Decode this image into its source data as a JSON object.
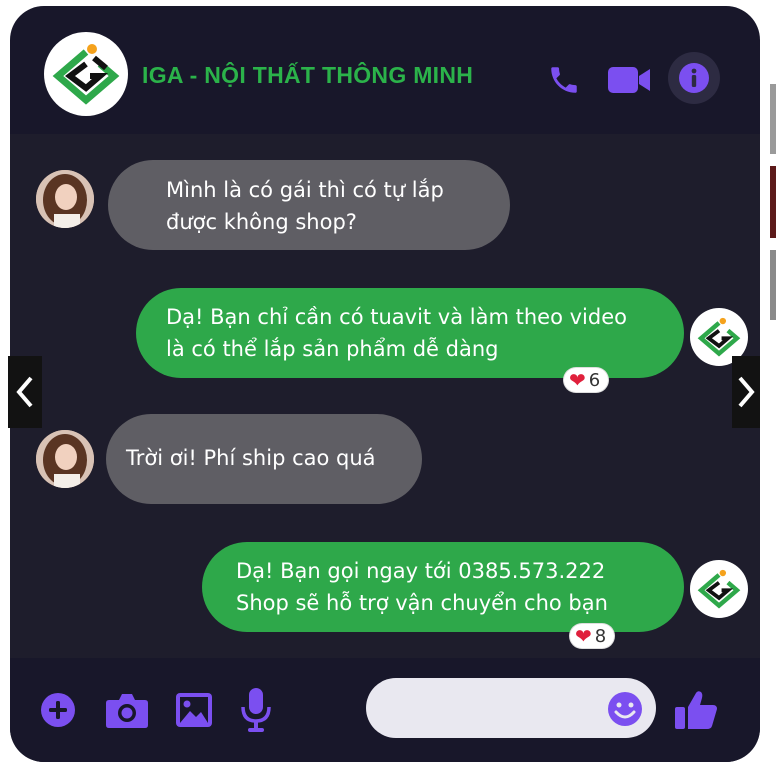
{
  "header": {
    "title": "IGA - NỘI THẤT THÔNG MINH",
    "logo_icon": "iga-logo-icon",
    "call_icon": "phone-icon",
    "video_icon": "video-camera-icon",
    "info_icon": "info-icon",
    "accent_color": "#7b4ff0",
    "title_color": "#2bb34a"
  },
  "messages": [
    {
      "from": "customer",
      "text": "Mình là có gái thì có tự lắp\nđược không shop?"
    },
    {
      "from": "shop",
      "text": "Dạ! Bạn chỉ cần có tuavit và làm theo video\nlà có thể lắp sản phẩm dễ dàng",
      "reaction": {
        "icon": "heart-icon",
        "count": "6"
      }
    },
    {
      "from": "customer",
      "text": "Trời ơi! Phí ship cao quá"
    },
    {
      "from": "shop",
      "text": "Dạ! Bạn gọi ngay tới 0385.573.222\nShop sẽ hỗ trợ vận chuyển cho bạn",
      "reaction": {
        "icon": "heart-icon",
        "count": "8"
      }
    }
  ],
  "footer": {
    "icons": [
      "plus-circle-icon",
      "camera-icon",
      "image-icon",
      "microphone-icon",
      "emoji-icon",
      "thumbs-up-icon"
    ],
    "input_value": ""
  },
  "nav": {
    "prev_icon": "chevron-left-icon",
    "next_icon": "chevron-right-icon"
  }
}
